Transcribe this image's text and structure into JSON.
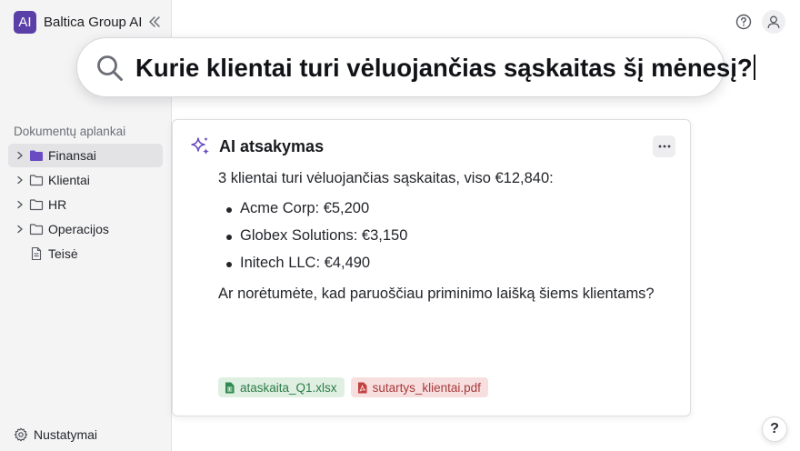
{
  "app": {
    "logo_text": "AI",
    "name": "Baltica Group AI"
  },
  "sidebar": {
    "section_label": "Dokumentų aplankai",
    "folders": [
      {
        "label": "Finansai",
        "icon": "folder-filled-icon",
        "active": true,
        "expandable": true
      },
      {
        "label": "Klientai",
        "icon": "folder-icon",
        "active": false,
        "expandable": true
      },
      {
        "label": "HR",
        "icon": "folder-icon",
        "active": false,
        "expandable": true
      },
      {
        "label": "Operacijos",
        "icon": "folder-icon",
        "active": false,
        "expandable": true
      },
      {
        "label": "Teisė",
        "icon": "document-icon",
        "active": false,
        "expandable": false
      }
    ],
    "settings_label": "Nustatymai"
  },
  "search": {
    "query": "Kurie klientai turi vėluojančias sąskaitas šį mėnesį?"
  },
  "answer": {
    "title": "AI atsakymas",
    "summary": "3 klientai turi vėluojančias sąskaitas, viso €12,840:",
    "items": [
      {
        "text": "Acme Corp: €5,200"
      },
      {
        "text": "Globex Solutions: €3,150"
      },
      {
        "text": "Initech LLC: €4,490"
      }
    ],
    "question": "Ar norėtumėte, kad paruoščiau priminimo laišką šiems klientams?",
    "attachments": [
      {
        "name": "ataskaita_Q1.xlsx",
        "type": "xlsx"
      },
      {
        "name": "sutartys_klientai.pdf",
        "type": "pdf"
      }
    ]
  },
  "help_fab_label": "?",
  "colors": {
    "accent": "#5b3fa8",
    "xlsx": "#2d7a45",
    "pdf": "#a83a3a"
  }
}
